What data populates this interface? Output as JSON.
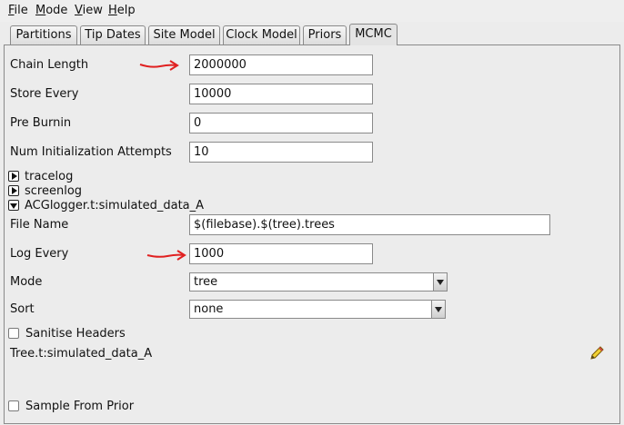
{
  "menubar": {
    "items": [
      {
        "label_first": "F",
        "label_rest": "ile"
      },
      {
        "label_first": "M",
        "label_rest": "ode"
      },
      {
        "label_first": "V",
        "label_rest": "iew"
      },
      {
        "label_first": "H",
        "label_rest": "elp"
      }
    ]
  },
  "tabs": [
    "Partitions",
    "Tip Dates",
    "Site Model",
    "Clock Model",
    "Priors",
    "MCMC"
  ],
  "active_tab": "MCMC",
  "mcmc": {
    "chain_length": {
      "label": "Chain Length",
      "value": "2000000"
    },
    "store_every": {
      "label": "Store Every",
      "value": "10000"
    },
    "pre_burnin": {
      "label": "Pre Burnin",
      "value": "0"
    },
    "num_init_attempts": {
      "label": "Num Initialization Attempts",
      "value": "10"
    },
    "loggers": {
      "tracelog": "tracelog",
      "screenlog": "screenlog",
      "acglogger": "ACGlogger.t:simulated_data_A"
    },
    "file_name": {
      "label": "File Name",
      "value": "$(filebase).$(tree).trees"
    },
    "log_every": {
      "label": "Log Every",
      "value": "1000"
    },
    "mode": {
      "label": "Mode",
      "selected": "tree"
    },
    "sort": {
      "label": "Sort",
      "selected": "none"
    },
    "sanitise_headers": {
      "label": "Sanitise Headers",
      "checked": false
    },
    "tree_item": "Tree.t:simulated_data_A",
    "sample_from_prior": {
      "label": "Sample From Prior",
      "checked": false
    }
  },
  "annotation_color": "#e02020",
  "icons": {
    "edit": "pencil-icon"
  }
}
